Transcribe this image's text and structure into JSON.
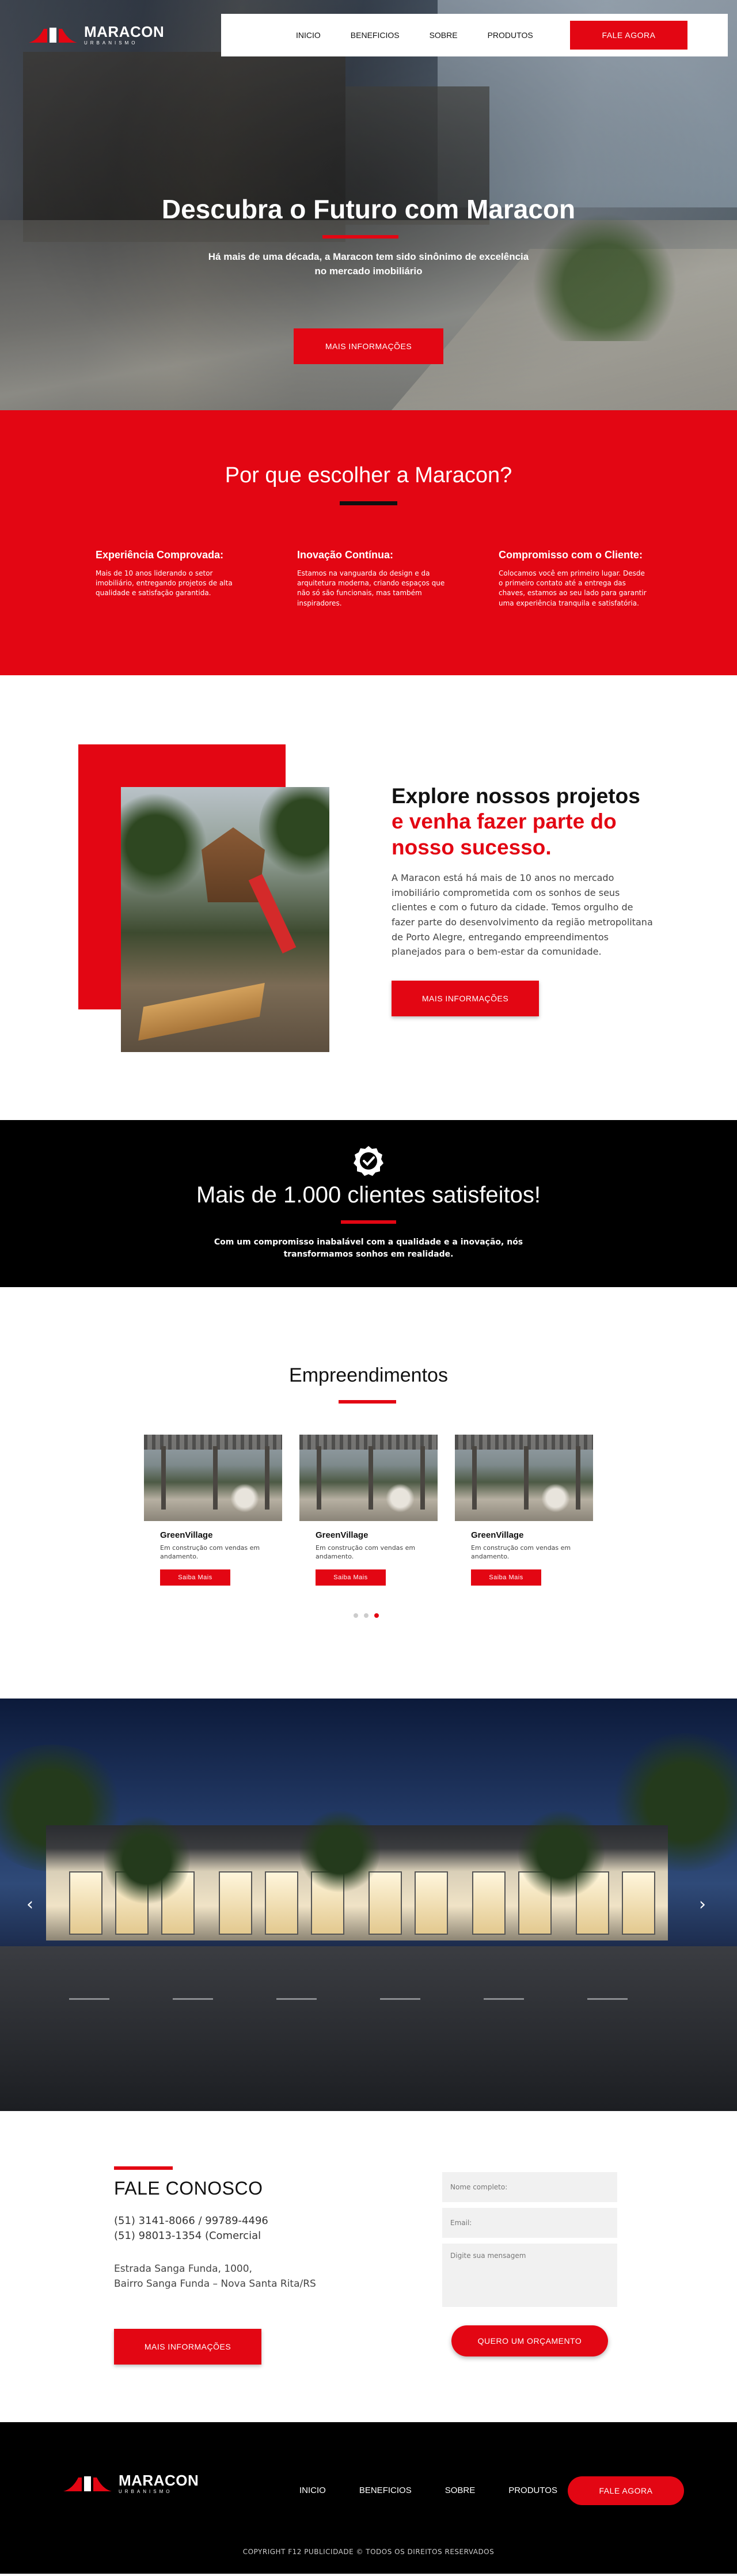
{
  "brand": {
    "name": "MARACON",
    "tagline": "URBANISMO"
  },
  "nav": {
    "items": [
      "INICIO",
      "BENEFICIOS",
      "SOBRE",
      "PRODUTOS"
    ],
    "cta": "FALE AGORA"
  },
  "hero": {
    "title": "Descubra o Futuro com Maracon",
    "subtitle": "Há mais de uma década, a Maracon tem sido sinônimo de excelência no mercado imobiliário",
    "button": "MAIS INFORMAÇÕES"
  },
  "why": {
    "title": "Por que escolher a Maracon?",
    "columns": [
      {
        "title": "Experiência Comprovada:",
        "text": "Mais de 10 anos liderando o setor imobiliário, entregando projetos de alta qualidade e satisfação garantida."
      },
      {
        "title": "Inovação Contínua:",
        "text": "Estamos na vanguarda do design e da arquitetura moderna, criando espaços que não só são funcionais, mas também inspiradores."
      },
      {
        "title": "Compromisso com o Cliente:",
        "text": "Colocamos você em primeiro lugar. Desde o primeiro contato até a entrega das chaves, estamos ao seu lado para garantir uma experiência tranquila e satisfatória."
      }
    ]
  },
  "explore": {
    "title_line1": "Explore nossos projetos",
    "title_red": "e venha fazer parte do nosso sucesso.",
    "text": "A Maracon está há mais de 10 anos no mercado imobiliário comprometida com os sonhos de seus clientes e com o futuro da cidade. Temos orgulho de fazer parte do desenvolvimento da região metropolitana de Porto Alegre, entregando empreendimentos planejados para o bem-estar da comunidade.",
    "button": "MAIS INFORMAÇÕES"
  },
  "clients": {
    "title": "Mais de 1.000 clientes satisfeitos!",
    "text": "Com um compromisso inabalável com a qualidade e a inovação, nós transformamos sonhos em realidade."
  },
  "projects": {
    "title": "Empreendimentos",
    "items": [
      {
        "name": "GreenVillage",
        "status": "Em construção com vendas em andamento.",
        "button": "Saiba Mais"
      },
      {
        "name": "GreenVillage",
        "status": "Em construção com vendas em andamento.",
        "button": "Saiba Mais"
      },
      {
        "name": "GreenVillage",
        "status": "Em construção com vendas em andamento.",
        "button": "Saiba Mais"
      }
    ],
    "active_dot": 3,
    "dot_count": 3
  },
  "slider": {
    "prev": "‹",
    "next": "›"
  },
  "contact": {
    "title": "FALE CONOSCO",
    "phone1": "(51) 3141-8066 / 99789-4496",
    "phone2": "(51) 98013-1354 (Comercial",
    "address1": "Estrada Sanga Funda, 1000,",
    "address2": "Bairro Sanga Funda – Nova Santa Rita/RS",
    "button": "MAIS INFORMAÇÕES",
    "form": {
      "name_placeholder": "Nome completo:",
      "email_placeholder": "Email:",
      "message_placeholder": "Digite sua mensagem",
      "submit": "QUERO UM ORÇAMENTO"
    }
  },
  "footer": {
    "nav": [
      "INICIO",
      "BENEFICIOS",
      "SOBRE",
      "PRODUTOS"
    ],
    "cta": "FALE AGORA",
    "copyright": "COPYRIGHT F12 PUBLICIDADE © TODOS OS DIREITOS RESERVADOS"
  },
  "colors": {
    "accent": "#e30613",
    "dark": "#000000"
  }
}
